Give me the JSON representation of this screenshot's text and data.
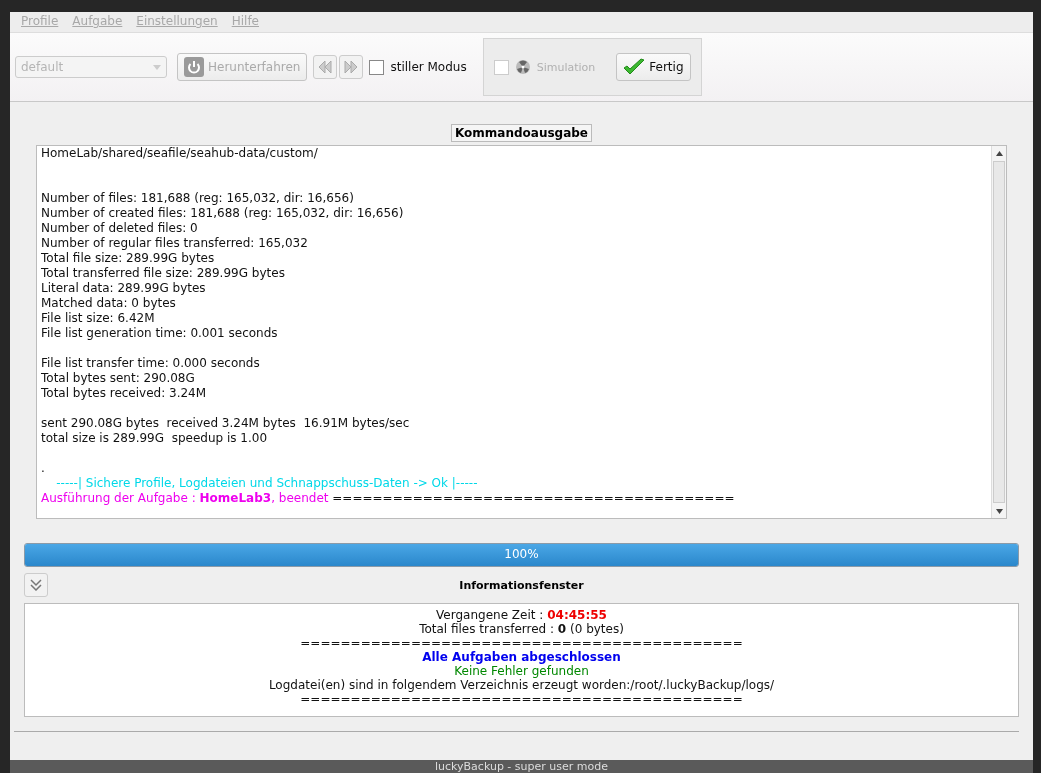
{
  "menu": [
    "Profile",
    "Aufgabe",
    "Einstellungen",
    "Hilfe"
  ],
  "toolbar": {
    "profile": {
      "value": "default",
      "disabled": true
    },
    "shutdown": {
      "label": "Herunterfahren",
      "disabled": true
    },
    "silent": {
      "label": "stiller Modus",
      "checked": false
    },
    "simulation": {
      "label": "Simulation",
      "checked": false,
      "disabled": true
    },
    "done": {
      "label": "Fertig"
    }
  },
  "output": {
    "title": "Kommandoausgabe",
    "lines": [
      {
        "kind": "plain",
        "text": "HomeLab/shared/seafile/seahub-data/custom/"
      },
      {
        "kind": "blank"
      },
      {
        "kind": "blank"
      },
      {
        "kind": "plain",
        "text": "Number of files: 181,688 (reg: 165,032, dir: 16,656)"
      },
      {
        "kind": "plain",
        "text": "Number of created files: 181,688 (reg: 165,032, dir: 16,656)"
      },
      {
        "kind": "plain",
        "text": "Number of deleted files: 0"
      },
      {
        "kind": "plain",
        "text": "Number of regular files transferred: 165,032"
      },
      {
        "kind": "plain",
        "text": "Total file size: 289.99G bytes"
      },
      {
        "kind": "plain",
        "text": "Total transferred file size: 289.99G bytes"
      },
      {
        "kind": "plain",
        "text": "Literal data: 289.99G bytes"
      },
      {
        "kind": "plain",
        "text": "Matched data: 0 bytes"
      },
      {
        "kind": "plain",
        "text": "File list size: 6.42M"
      },
      {
        "kind": "plain",
        "text": "File list generation time: 0.001 seconds"
      },
      {
        "kind": "blank"
      },
      {
        "kind": "plain",
        "text": "File list transfer time: 0.000 seconds"
      },
      {
        "kind": "plain",
        "text": "Total bytes sent: 290.08G"
      },
      {
        "kind": "plain",
        "text": "Total bytes received: 3.24M"
      },
      {
        "kind": "blank"
      },
      {
        "kind": "plain",
        "text": "sent 290.08G bytes  received 3.24M bytes  16.91M bytes/sec"
      },
      {
        "kind": "plain",
        "text": "total size is 289.99G  speedup is 1.00"
      },
      {
        "kind": "blank"
      },
      {
        "kind": "plain",
        "text": "."
      },
      {
        "kind": "note",
        "text": "    -----| Sichere Profile, Logdateien und Schnappschuss-Daten -> Ok |-----"
      },
      {
        "kind": "result",
        "text": "Ausführung der Aufgabe : **HomeLab3**, beendet",
        "tail": "========================================"
      }
    ]
  },
  "progress": {
    "level": 1,
    "label": "100%"
  },
  "info": {
    "title": "Informationsfenster",
    "lines": [
      {
        "kind": "pair",
        "text": "Vergangene Zeit :",
        "value": "04:45:55"
      },
      {
        "kind": "plain",
        "text": "Total files transferred : **0** (0 bytes)"
      },
      {
        "kind": "plain",
        "text": "============================================"
      },
      {
        "kind": "heading",
        "text": "Alle Aufgaben abgeschlossen"
      },
      {
        "kind": "ok",
        "text": "Keine Fehler gefunden"
      },
      {
        "kind": "plain",
        "text": "Logdatei(en) sind in folgendem Verzeichnis erzeugt worden:/root/.luckyBackup/logs/"
      },
      {
        "kind": "plain",
        "text": "============================================"
      }
    ]
  },
  "taskbar": {
    "title": "luckyBackup - super user mode"
  }
}
